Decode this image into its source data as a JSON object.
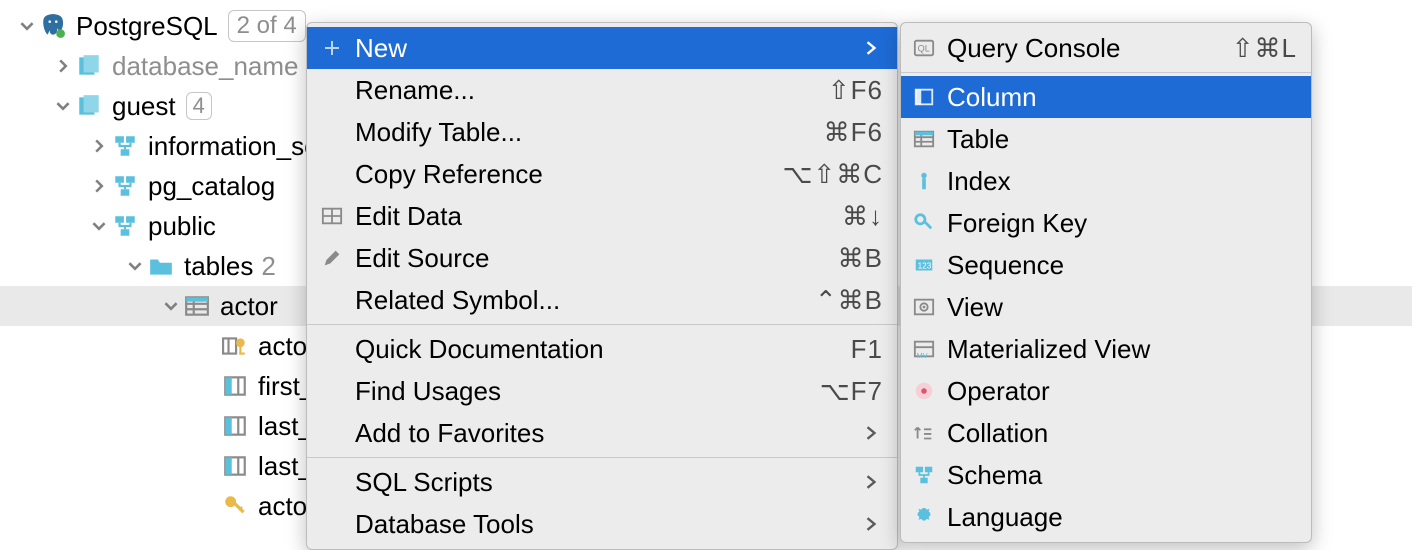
{
  "tree": {
    "root": {
      "label": "PostgreSQL",
      "badge": "2 of 4"
    },
    "db": {
      "label": "database_name"
    },
    "guest": {
      "label": "guest",
      "badge": "4"
    },
    "schemas": {
      "information": "information_schema",
      "pg_catalog": "pg_catalog",
      "public": "public"
    },
    "tables_label": "tables",
    "tables_badge": "2",
    "table_actor": "actor",
    "columns": {
      "c0": "actor_id",
      "c1": "first_name",
      "c2": "last_name",
      "c3": "last_update",
      "c4": "actor_pkey"
    }
  },
  "menu": {
    "new": "New",
    "rename": "Rename...",
    "modify": "Modify Table...",
    "copyref": "Copy Reference",
    "editdata": "Edit Data",
    "editsource": "Edit Source",
    "related": "Related Symbol...",
    "quickdoc": "Quick Documentation",
    "findusages": "Find Usages",
    "favorites": "Add to Favorites",
    "sqlscripts": "SQL Scripts",
    "dbtools": "Database Tools",
    "short": {
      "rename": "⇧F6",
      "modify": "⌘F6",
      "copyref": "⌥⇧⌘C",
      "editdata": "⌘↓",
      "editsource": "⌘B",
      "related": "⌃⌘B",
      "quickdoc": "F1",
      "findusages": "⌥F7"
    }
  },
  "submenu": {
    "query": "Query Console",
    "query_short": "⇧⌘L",
    "column": "Column",
    "table": "Table",
    "index": "Index",
    "fk": "Foreign Key",
    "sequence": "Sequence",
    "view": "View",
    "mview": "Materialized View",
    "operator": "Operator",
    "collation": "Collation",
    "schema": "Schema",
    "language": "Language"
  }
}
